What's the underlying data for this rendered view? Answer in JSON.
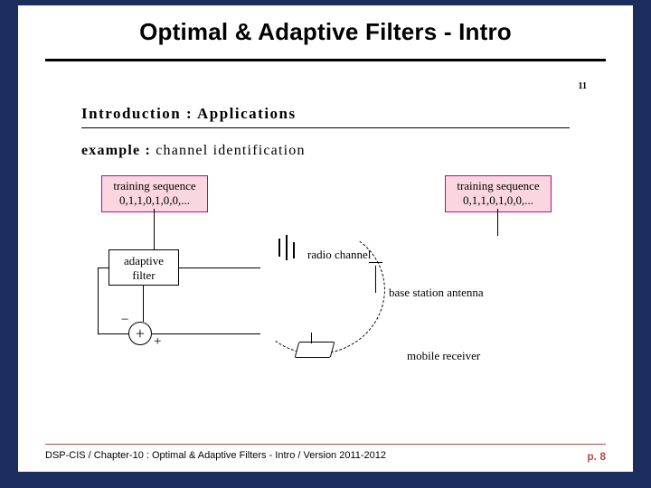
{
  "title": "Optimal & Adaptive Filters - Intro",
  "inner_page_tag": "11",
  "section_header": "Introduction : Applications",
  "example": {
    "label": "example :",
    "text": " channel identification"
  },
  "diagram": {
    "training_sequence_left": "training sequence\n0,1,1,0,1,0,0,...",
    "training_sequence_right": "training sequence\n0,1,1,0,1,0,0,...",
    "adaptive_filter": "adaptive\nfilter",
    "radio_channel": "radio channel",
    "base_station_antenna": "base station antenna",
    "mobile_receiver": "mobile receiver",
    "sum_symbol": "+",
    "sign_minus": "−",
    "sign_plus": "+"
  },
  "footer": {
    "left": "DSP-CIS / Chapter-10 : Optimal & Adaptive Filters - Intro / Version 2011-2012",
    "page": "p. 8"
  }
}
